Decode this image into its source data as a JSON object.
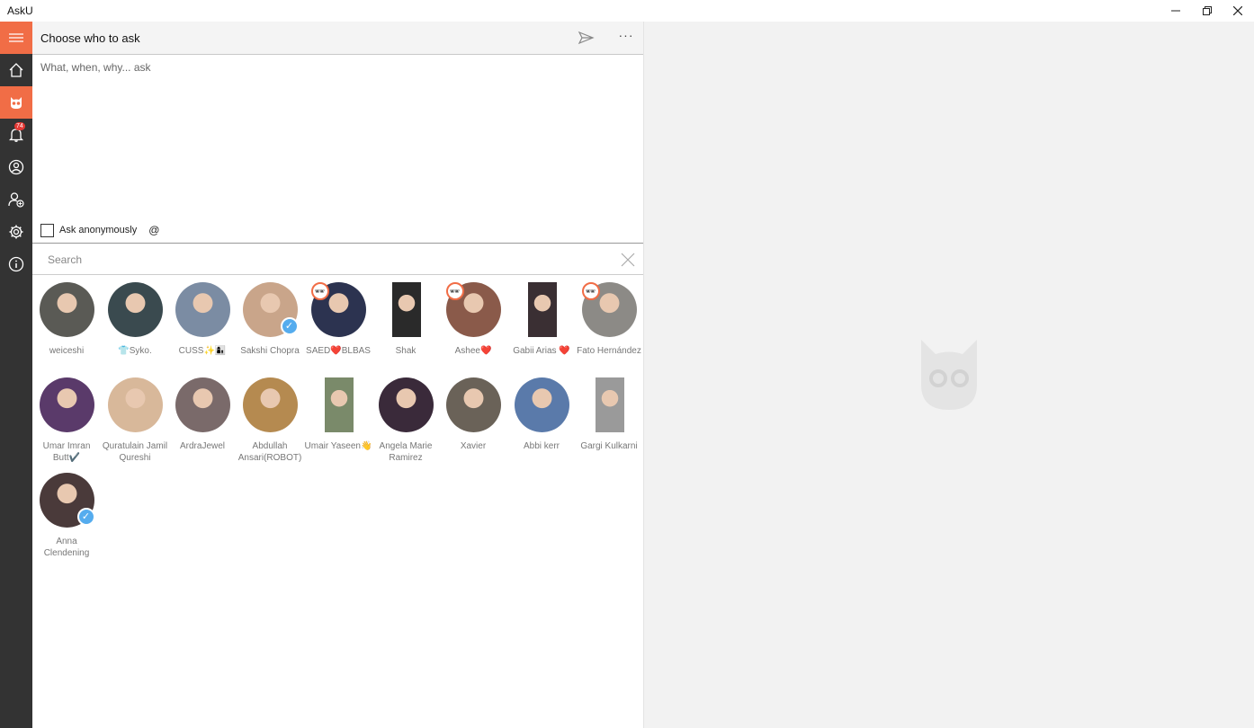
{
  "window": {
    "title": "AskU",
    "minimize_icon": "minimize-icon",
    "restore_icon": "restore-icon",
    "close_icon": "close-icon"
  },
  "sidebar": {
    "items": [
      {
        "name": "hamburger-menu",
        "icon": "hamburger-icon"
      },
      {
        "name": "home",
        "icon": "home-icon"
      },
      {
        "name": "ask",
        "icon": "owl-icon",
        "active": true
      },
      {
        "name": "notifications",
        "icon": "bell-icon",
        "badge": "74"
      },
      {
        "name": "profile",
        "icon": "user-circle-icon"
      },
      {
        "name": "add-friend",
        "icon": "user-add-icon"
      },
      {
        "name": "settings",
        "icon": "gear-icon"
      },
      {
        "name": "about",
        "icon": "info-icon"
      }
    ],
    "accent_color": "#f16d46",
    "background_color": "#333333"
  },
  "header": {
    "title": "Choose who to ask",
    "send_icon": "send-icon",
    "more_label": "···"
  },
  "question": {
    "placeholder": "What, when, why... ask",
    "value": ""
  },
  "options": {
    "anonymous_label": "Ask anonymously",
    "anonymous_checked": false,
    "mention_label": "@"
  },
  "search": {
    "placeholder": "Search",
    "value": ""
  },
  "users": [
    {
      "name": "weiceshi",
      "color": "#5a5a55"
    },
    {
      "name": "👕Syko.",
      "color": "#3a4a4f"
    },
    {
      "name": "CUSS✨👩‍👦",
      "color": "#7b8ca3"
    },
    {
      "name": "Sakshi Chopra",
      "color": "#c9a58a",
      "verified": true
    },
    {
      "name": "SAED❤️BLBAS",
      "color": "#2c3350",
      "anonymous": true
    },
    {
      "name": "Shak",
      "color": "#2a2a2a",
      "square": true
    },
    {
      "name": "Ashee❤️",
      "color": "#8a5a4a",
      "anonymous": true
    },
    {
      "name": "Gabii Arias ❤️",
      "color": "#3a2f33",
      "square": true
    },
    {
      "name": "Fato Hernández",
      "color": "#8c8a86",
      "anonymous": true
    },
    {
      "name": "Umar Imran Butt✔️",
      "color": "#5a3a6a"
    },
    {
      "name": "Quratulain Jamil Qureshi",
      "color": "#d8b89a"
    },
    {
      "name": "ArdraJewel",
      "color": "#7a6a6a"
    },
    {
      "name": "Abdullah Ansari(ROBOT)",
      "color": "#b58a50"
    },
    {
      "name": "Umair Yaseen👋",
      "color": "#7a8a6a",
      "square": true
    },
    {
      "name": "Angela Marie Ramirez",
      "color": "#3a2a3a"
    },
    {
      "name": "Xavier",
      "color": "#6a6258"
    },
    {
      "name": "Abbi kerr",
      "color": "#5a7aaa"
    },
    {
      "name": "Gargi Kulkarni",
      "color": "#9a9a9a",
      "square": true
    },
    {
      "name": "Anna Clendening",
      "color": "#4a3a3a",
      "verified": true
    }
  ],
  "right_panel": {
    "icon": "cat-logo-icon"
  }
}
